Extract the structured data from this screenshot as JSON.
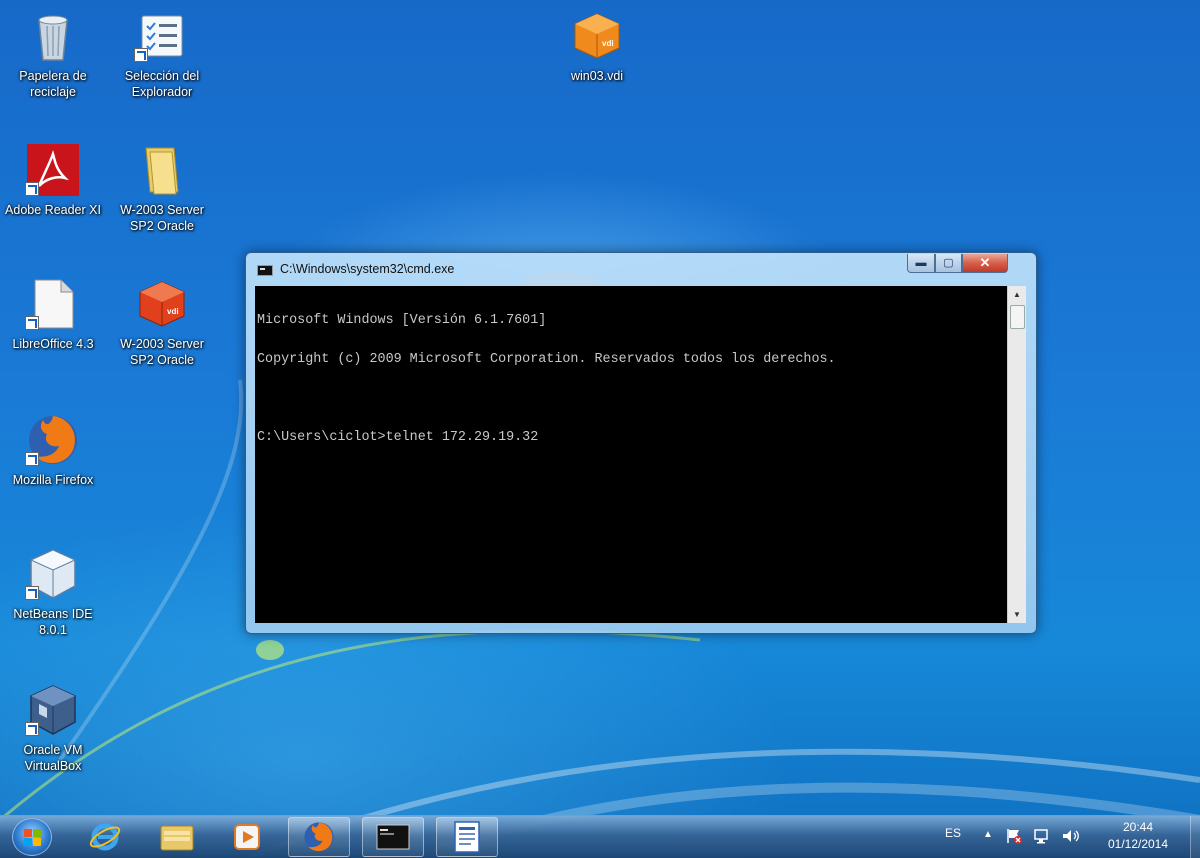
{
  "desktop": {
    "icons": [
      {
        "label": "Papelera de reciclaje",
        "icon": "recycle-bin-icon"
      },
      {
        "label": "Selección del Explorador",
        "icon": "explorer-selection-icon"
      },
      {
        "label": "win03.vdi",
        "icon": "vdi-disk-icon"
      },
      {
        "label": "Adobe Reader XI",
        "icon": "adobe-reader-icon"
      },
      {
        "label": "W-2003 Server SP2 Oracle",
        "icon": "folder-icon"
      },
      {
        "label": "LibreOffice 4.3",
        "icon": "libreoffice-icon"
      },
      {
        "label": "W-2003 Server SP2 Oracle",
        "icon": "vdi-disk-icon"
      },
      {
        "label": "Mozilla Firefox",
        "icon": "firefox-icon"
      },
      {
        "label": "NetBeans IDE 8.0.1",
        "icon": "netbeans-icon"
      },
      {
        "label": "Oracle VM VirtualBox",
        "icon": "virtualbox-icon"
      }
    ]
  },
  "cmd_window": {
    "title": "C:\\Windows\\system32\\cmd.exe",
    "controls": {
      "minimize": "▬",
      "maximize": "▢",
      "close": "✕"
    },
    "lines": [
      "Microsoft Windows [Versión 6.1.7601]",
      "Copyright (c) 2009 Microsoft Corporation. Reservados todos los derechos.",
      "",
      "C:\\Users\\ciclot>telnet 172.29.19.32"
    ],
    "colors": {
      "background": "#000000",
      "text": "#c8c8c8"
    }
  },
  "taskbar": {
    "pinned": [
      "internet-explorer-icon",
      "file-explorer-icon",
      "media-player-icon",
      "firefox-icon",
      "cmd-icon",
      "wordpad-icon"
    ],
    "tray": {
      "language": "ES",
      "time": "20:44",
      "date": "01/12/2014"
    }
  }
}
